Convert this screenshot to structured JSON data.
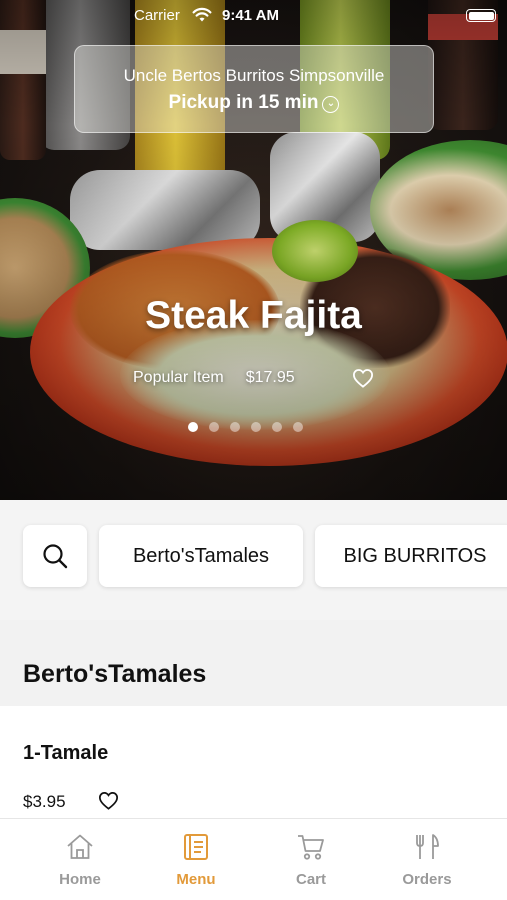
{
  "status_bar": {
    "carrier": "Carrier",
    "time": "9:41 AM"
  },
  "store": {
    "name": "Uncle Bertos Burritos Simpsonville",
    "pickup": "Pickup in 15 min"
  },
  "featured": {
    "title": "Steak Fajita",
    "tag": "Popular Item",
    "price": "$17.95",
    "carousel_count": 6,
    "carousel_active": 0
  },
  "categories": [
    "Berto'sTamales",
    "BIG BURRITOS"
  ],
  "section": {
    "title": "Berto'sTamales"
  },
  "items": [
    {
      "name": "1-Tamale",
      "price": "$3.95"
    }
  ],
  "tabs": [
    {
      "label": "Home",
      "icon": "home-icon",
      "active": false
    },
    {
      "label": "Menu",
      "icon": "menu-book-icon",
      "active": true
    },
    {
      "label": "Cart",
      "icon": "cart-icon",
      "active": false
    },
    {
      "label": "Orders",
      "icon": "fork-knife-icon",
      "active": false
    }
  ],
  "colors": {
    "accent": "#e29a3a",
    "inactive_tab": "#9a9a9a",
    "background": "#f4f4f4"
  }
}
